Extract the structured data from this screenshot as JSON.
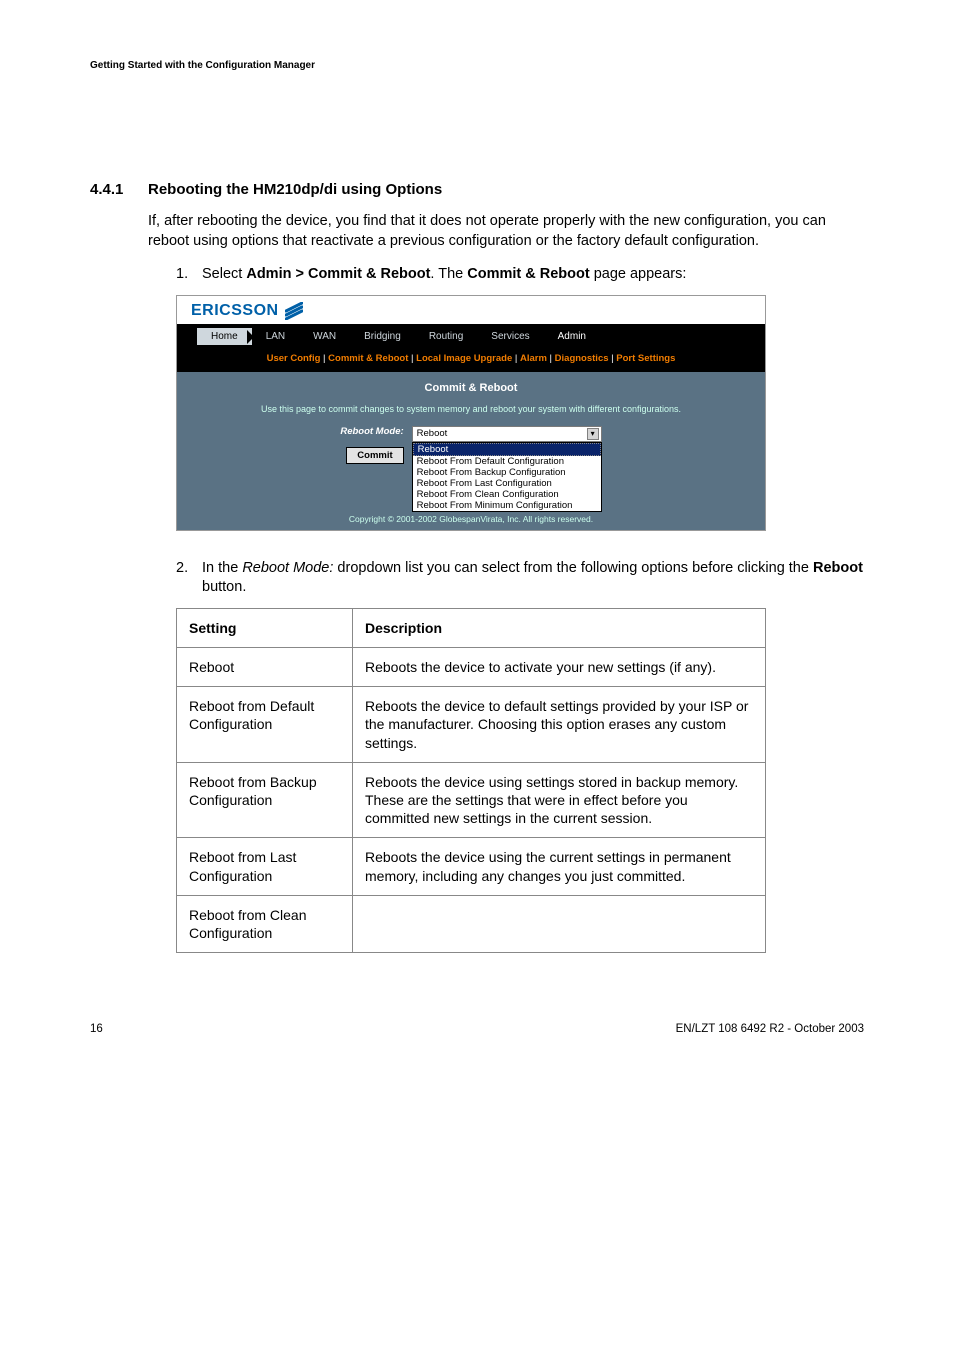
{
  "running_head": "Getting Started with the Configuration Manager",
  "section": {
    "number": "4.4.1",
    "title": "Rebooting the HM210dp/di using Options"
  },
  "intro_para": "If, after rebooting the device, you find that it does not operate properly with the new configuration, you can reboot using options that reactivate a previous configuration or the factory default configuration.",
  "step1": {
    "num": "1.",
    "pre": "Select ",
    "bold1": "Admin > Commit & Reboot",
    "mid": ". The ",
    "bold2": "Commit & Reboot",
    "post": " page appears:"
  },
  "screenshot": {
    "logo": "ERICSSON",
    "tabs": [
      "Home",
      "LAN",
      "WAN",
      "Bridging",
      "Routing",
      "Services",
      "Admin"
    ],
    "subnav": {
      "items": [
        "User Config",
        "Commit & Reboot",
        "Local Image Upgrade",
        "Alarm",
        "Diagnostics",
        "Port Settings"
      ],
      "sep": " | "
    },
    "panel_title": "Commit & Reboot",
    "panel_desc": "Use this page to commit changes to system memory and reboot your system with different configurations.",
    "mode_label": "Reboot Mode:",
    "selected": "Reboot",
    "options": [
      "Reboot",
      "Reboot From Default Configuration",
      "Reboot From Backup Configuration",
      "Reboot From Last Configuration",
      "Reboot From Clean Configuration",
      "Reboot From Minimum Configuration"
    ],
    "commit_btn": "Commit",
    "copyright": "Copyright © 2001-2002 GlobespanVirata, Inc. All rights reserved."
  },
  "step2": {
    "num": "2.",
    "pre": "In the ",
    "ital": "Reboot Mode:",
    "mid": " dropdown list you can select from the following options before clicking the ",
    "bold": "Reboot",
    "post": " button."
  },
  "table": {
    "headers": [
      "Setting",
      "Description"
    ],
    "rows": [
      {
        "setting": "Reboot",
        "desc": "Reboots the device to activate your new settings (if any)."
      },
      {
        "setting": "Reboot from Default Configuration",
        "desc": "Reboots the device to default settings provided by your ISP or the manufacturer. Choosing this option erases any custom settings."
      },
      {
        "setting": "Reboot from Backup Configuration",
        "desc": "Reboots the device using settings stored in backup memory. These are the settings that were in effect before you committed new settings in the current session."
      },
      {
        "setting": "Reboot from Last Configuration",
        "desc": "Reboots the device using the current settings in permanent memory, including any changes you just committed."
      },
      {
        "setting": "Reboot from Clean Configuration",
        "desc": ""
      }
    ]
  },
  "footer": {
    "page": "16",
    "doc": "EN/LZT 108 6492 R2  - October 2003"
  }
}
